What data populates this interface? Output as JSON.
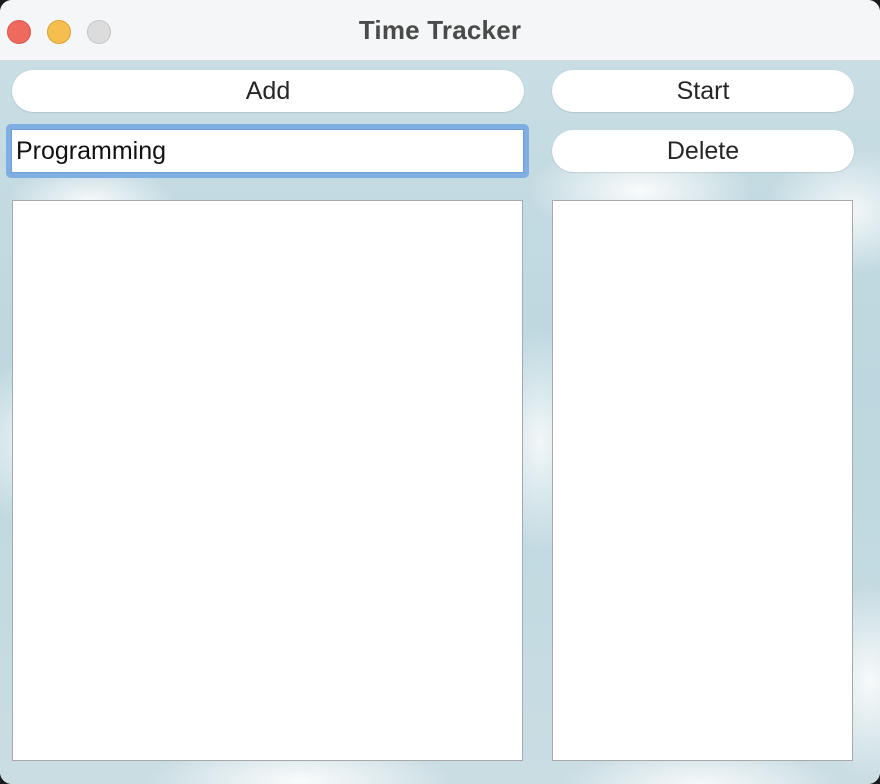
{
  "window": {
    "title": "Time Tracker"
  },
  "toolbar": {
    "add_label": "Add",
    "start_label": "Start",
    "delete_label": "Delete"
  },
  "task_entry": {
    "value": "Programming"
  },
  "task_list": {
    "items": []
  },
  "time_list": {
    "items": []
  },
  "colors": {
    "close": "#ee6a5f",
    "minimize": "#f5be4f",
    "zoom": "#dcdcdc",
    "focus_ring": "#7eaee2"
  }
}
